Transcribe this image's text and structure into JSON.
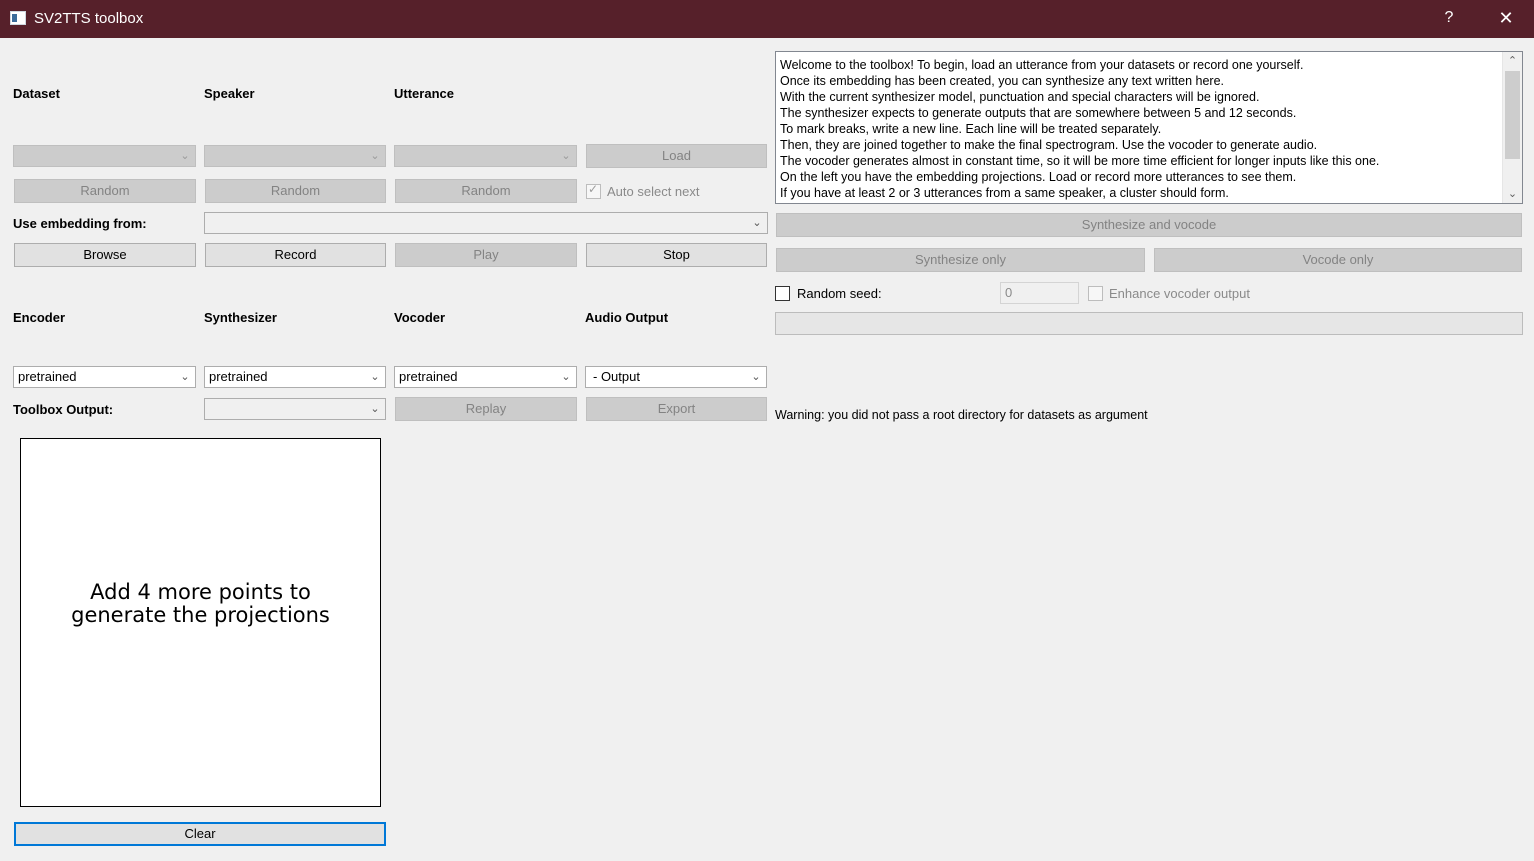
{
  "window": {
    "title": "SV2TTS toolbox",
    "help": "?",
    "close": "✕"
  },
  "dataset": {
    "labels": {
      "dataset": "Dataset",
      "speaker": "Speaker",
      "utterance": "Utterance"
    },
    "load_label": "Load",
    "random_label": "Random",
    "auto_select_label": "Auto select next",
    "use_embedding_label": "Use embedding from:",
    "browse_label": "Browse",
    "record_label": "Record",
    "play_label": "Play",
    "stop_label": "Stop"
  },
  "models": {
    "labels": {
      "encoder": "Encoder",
      "synthesizer": "Synthesizer",
      "vocoder": "Vocoder",
      "audio_output": "Audio Output"
    },
    "encoder_value": "pretrained",
    "synthesizer_value": "pretrained",
    "vocoder_value": "pretrained",
    "audio_output_value": "- Output",
    "toolbox_output_label": "Toolbox Output:",
    "replay_label": "Replay",
    "export_label": "Export"
  },
  "text_log": [
    "Welcome to the toolbox! To begin, load an utterance from your datasets or record one yourself.",
    "Once its embedding has been created, you can synthesize any text written here.",
    "With the current synthesizer model, punctuation and special characters will be ignored.",
    "The synthesizer expects to generate outputs that are somewhere between 5 and 12 seconds.",
    "To mark breaks, write a new line. Each line will be treated separately.",
    "Then, they are joined together to make the final spectrogram. Use the vocoder to generate audio.",
    "The vocoder generates almost in constant time, so it will be more time efficient for longer inputs like this one.",
    "On the left you have the embedding projections. Load or record more utterances to see them.",
    "If you have at least 2 or 3 utterances from a same speaker, a cluster should form."
  ],
  "synth": {
    "synthesize_vocode_label": "Synthesize and vocode",
    "synthesize_only_label": "Synthesize only",
    "vocode_only_label": "Vocode only",
    "random_seed_label": "Random seed:",
    "seed_value": "0",
    "enhance_label": "Enhance vocoder output"
  },
  "warning": "Warning: you did not pass a root directory for datasets as argument",
  "projections": {
    "line1": "Add 4 more points to",
    "line2": "generate the projections"
  },
  "clear_label": "Clear",
  "colors": {
    "titlebar": "#56202a",
    "background": "#f0f0f0",
    "focus": "#0078d7"
  }
}
